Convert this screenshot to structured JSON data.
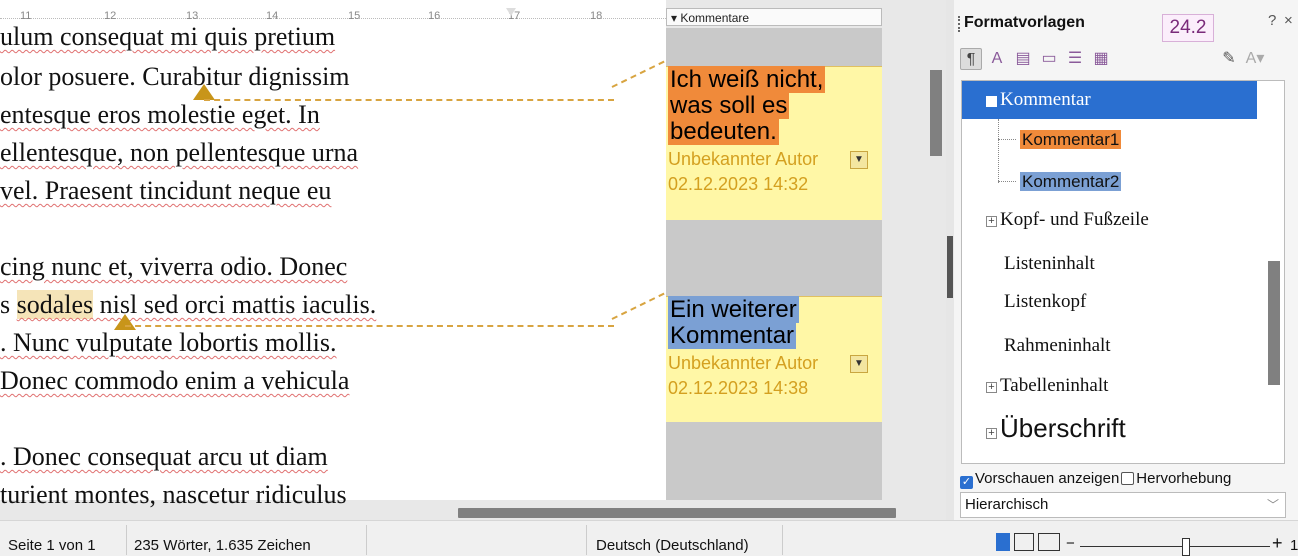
{
  "ruler": {
    "numbers": [
      "11",
      "12",
      "13",
      "14",
      "15",
      "16",
      "17",
      "18"
    ]
  },
  "comment_header": {
    "label": "▾ Kommentare"
  },
  "document": {
    "lines": [
      "ulum consequat mi quis pretium",
      "olor posuere. Curabitur dignissim",
      "entesque eros molestie eget. In",
      "ellentesque, non pellentesque urna",
      "vel. Praesent tincidunt neque eu",
      "cing nunc et, viverra odio. Donec",
      "s ",
      "sodales",
      " nisl sed orci mattis iaculis.",
      ". Nunc vulputate lobortis mollis.",
      " Donec commodo enim a vehicula",
      ". Donec consequat arcu ut diam",
      "turient montes, nascetur ridiculus"
    ]
  },
  "comments": [
    {
      "text": [
        "Ich weiß nicht,",
        "was soll es",
        "bedeuten."
      ],
      "author": "Unbekannter Autor",
      "date": "02.12.2023 14:32",
      "highlight": "#f08a3a"
    },
    {
      "text": [
        "Ein weiterer",
        "Kommentar"
      ],
      "author": "Unbekannter Autor",
      "date": "02.12.2023 14:38",
      "highlight": "#7ba0d4"
    }
  ],
  "sidebar": {
    "title": "Formatvorlagen",
    "version_badge": "24.2",
    "help": "?",
    "close": "×",
    "tree": [
      {
        "label": "Kommentar",
        "selected": true
      },
      {
        "label": "Kommentar1"
      },
      {
        "label": "Kommentar2"
      },
      {
        "label": "Kopf- und Fußzeile"
      },
      {
        "label": "Listeninhalt"
      },
      {
        "label": "Listenkopf"
      },
      {
        "label": "Rahmeninhalt"
      },
      {
        "label": "Tabelleninhalt"
      },
      {
        "label": "Überschrift"
      }
    ],
    "preview_label": "Vorschauen anzeigen",
    "preview_checked": true,
    "highlight_label": "Hervorhebung",
    "highlight_checked": false,
    "filter_value": "Hierarchisch"
  },
  "status": {
    "page": "Seite 1 von 1",
    "words": "235 Wörter, 1.635 Zeichen",
    "language": "Deutsch (Deutschland)",
    "zoom_minus": "−",
    "zoom_plus": "+",
    "zoom_value": "1"
  }
}
